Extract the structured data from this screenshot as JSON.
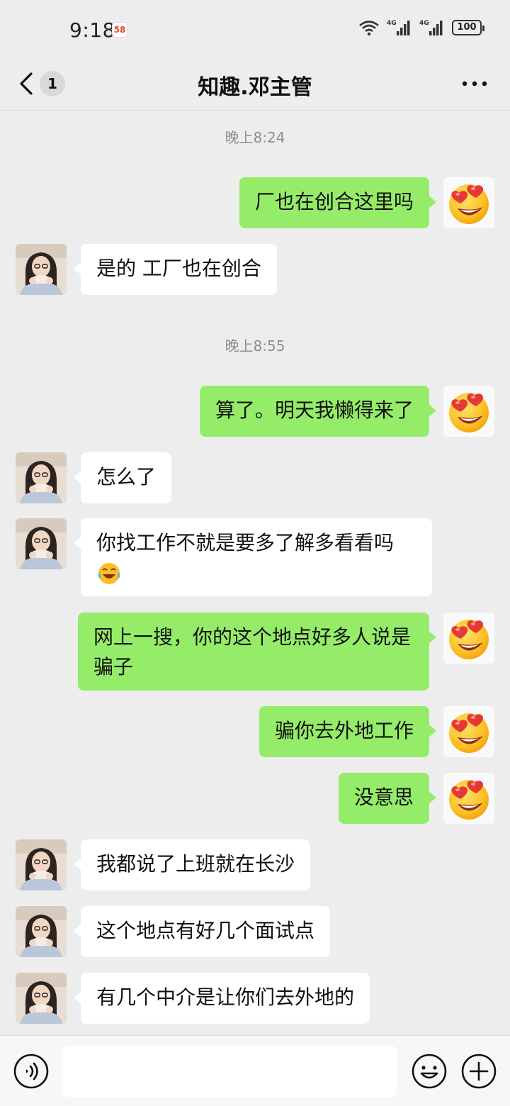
{
  "status_bar": {
    "time": "9:18",
    "app_badge": "58",
    "net_1": "4G",
    "net_2": "4G",
    "battery": "100"
  },
  "header": {
    "unread_count": "1",
    "title": "知趣.邓主管"
  },
  "messages": [
    {
      "type": "time",
      "text": "晚上8:24"
    },
    {
      "type": "sent",
      "text": "厂也在创合这里吗"
    },
    {
      "type": "received",
      "text": "是的 工厂也在创合"
    },
    {
      "type": "time",
      "text": "晚上8:55"
    },
    {
      "type": "sent",
      "text": "算了。明天我懒得来了"
    },
    {
      "type": "received",
      "text": "怎么了"
    },
    {
      "type": "received",
      "text": "你找工作不就是要多了解多看看吗",
      "emoji": "laugh-cry"
    },
    {
      "type": "sent",
      "text": "网上一搜，你的这个地点好多人说是骗子"
    },
    {
      "type": "sent",
      "text": "骗你去外地工作"
    },
    {
      "type": "sent",
      "text": "没意思"
    },
    {
      "type": "received",
      "text": "我都说了上班就在长沙"
    },
    {
      "type": "received",
      "text": "这个地点有好几个面试点"
    },
    {
      "type": "received",
      "text": "有几个中介是让你们去外地的"
    }
  ],
  "icons": {
    "back": "chevron-left-icon",
    "more": "more-dots-icon",
    "voice": "voice-icon",
    "emoji": "emoji-icon",
    "plus": "plus-icon",
    "self_avatar": "heart-eyes-emoji"
  },
  "colors": {
    "background": "#ededed",
    "sent_bubble": "#95ec69",
    "received_bubble": "#ffffff",
    "timestamp": "#8e8e8e"
  }
}
